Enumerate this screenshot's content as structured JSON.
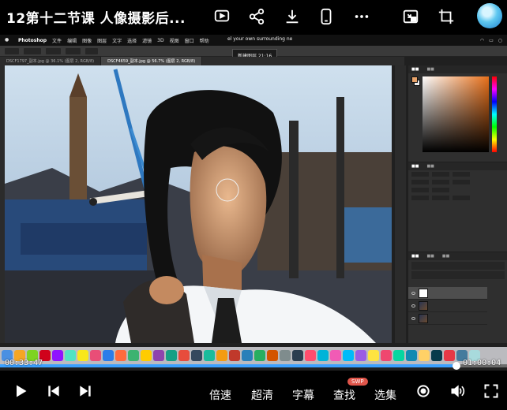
{
  "header": {
    "title": "12第十二节课 人像摄影后...",
    "icons": [
      "cast-icon",
      "share-icon",
      "download-icon",
      "phone-icon",
      "more-icon",
      "pip-icon",
      "crop-icon"
    ]
  },
  "screen": {
    "menubar": {
      "app": "Photoshop",
      "items": [
        "文件",
        "编辑",
        "图像",
        "图层",
        "文字",
        "选择",
        "滤镜",
        "3D",
        "视图",
        "窗口",
        "帮助"
      ],
      "overlay_title": "el your own surrounding ne"
    },
    "tooltip": "新建图层 21:16",
    "doc_tabs": [
      "DSCF1797_副本.jpg @ 36.1% (图层 2, RGB/8)",
      "DSCF4659_副本.jpg @ 56.7% (图层 2, RGB/8)"
    ]
  },
  "player": {
    "current_time": "00:33:47",
    "total_time": "01:00:04",
    "progress": 0.9,
    "accent": "#3aa0ff"
  },
  "controls": {
    "speed": "倍速",
    "quality": "超清",
    "subtitle": "字幕",
    "search": "查找",
    "search_badge": "SWP",
    "episodes": "选集"
  }
}
